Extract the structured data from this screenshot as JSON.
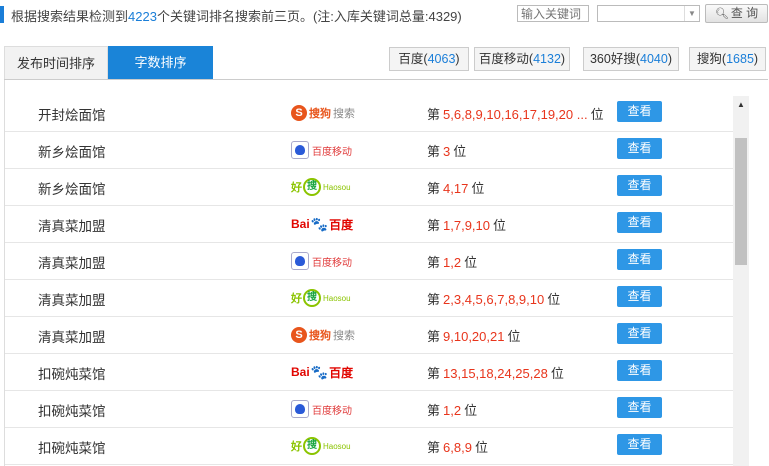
{
  "summary": {
    "prefix": "根据搜索结果检测到",
    "count": "4223",
    "suffix": "个关键词排名搜索前三页。(注:入库关键词总量:4329)"
  },
  "search": {
    "placeholder": "输入关键词",
    "engine_value": "",
    "query_label": "查 询"
  },
  "tabs": {
    "time_label": "发布时间排序",
    "words_label": "字数排序"
  },
  "engine_tabs": [
    {
      "name": "百度",
      "count": "4063"
    },
    {
      "name": "百度移动",
      "count": "4132"
    },
    {
      "name": "360好搜",
      "count": "4040"
    },
    {
      "name": "搜狗",
      "count": "1685"
    }
  ],
  "logos": {
    "sogou": {
      "icon": "S",
      "brand": "搜狗",
      "text": "搜索"
    },
    "baidu_mobile": {
      "text": "百度移动"
    },
    "haosou": {
      "hao": "好",
      "sou": "搜",
      "sub": "Haosou"
    },
    "baidu": {
      "bai": "Bai",
      "paw": "🐾",
      "du": "百度"
    }
  },
  "rank_prefix": "第",
  "rank_suffix": "位",
  "view_label": "查看",
  "rows": [
    {
      "keyword": "开封烩面馆",
      "engine": "sogou",
      "positions": "5,6,8,9,10,16,17,19,20 ..."
    },
    {
      "keyword": "新乡烩面馆",
      "engine": "baidu_mobile",
      "positions": "3"
    },
    {
      "keyword": "新乡烩面馆",
      "engine": "haosou",
      "positions": "4,17"
    },
    {
      "keyword": "清真菜加盟",
      "engine": "baidu",
      "positions": "1,7,9,10"
    },
    {
      "keyword": "清真菜加盟",
      "engine": "baidu_mobile",
      "positions": "1,2"
    },
    {
      "keyword": "清真菜加盟",
      "engine": "haosou",
      "positions": "2,3,4,5,6,7,8,9,10"
    },
    {
      "keyword": "清真菜加盟",
      "engine": "sogou",
      "positions": "9,10,20,21"
    },
    {
      "keyword": "扣碗炖菜馆",
      "engine": "baidu",
      "positions": "13,15,18,24,25,28"
    },
    {
      "keyword": "扣碗炖菜馆",
      "engine": "baidu_mobile",
      "positions": "1,2"
    },
    {
      "keyword": "扣碗炖菜馆",
      "engine": "haosou",
      "positions": "6,8,9"
    }
  ]
}
